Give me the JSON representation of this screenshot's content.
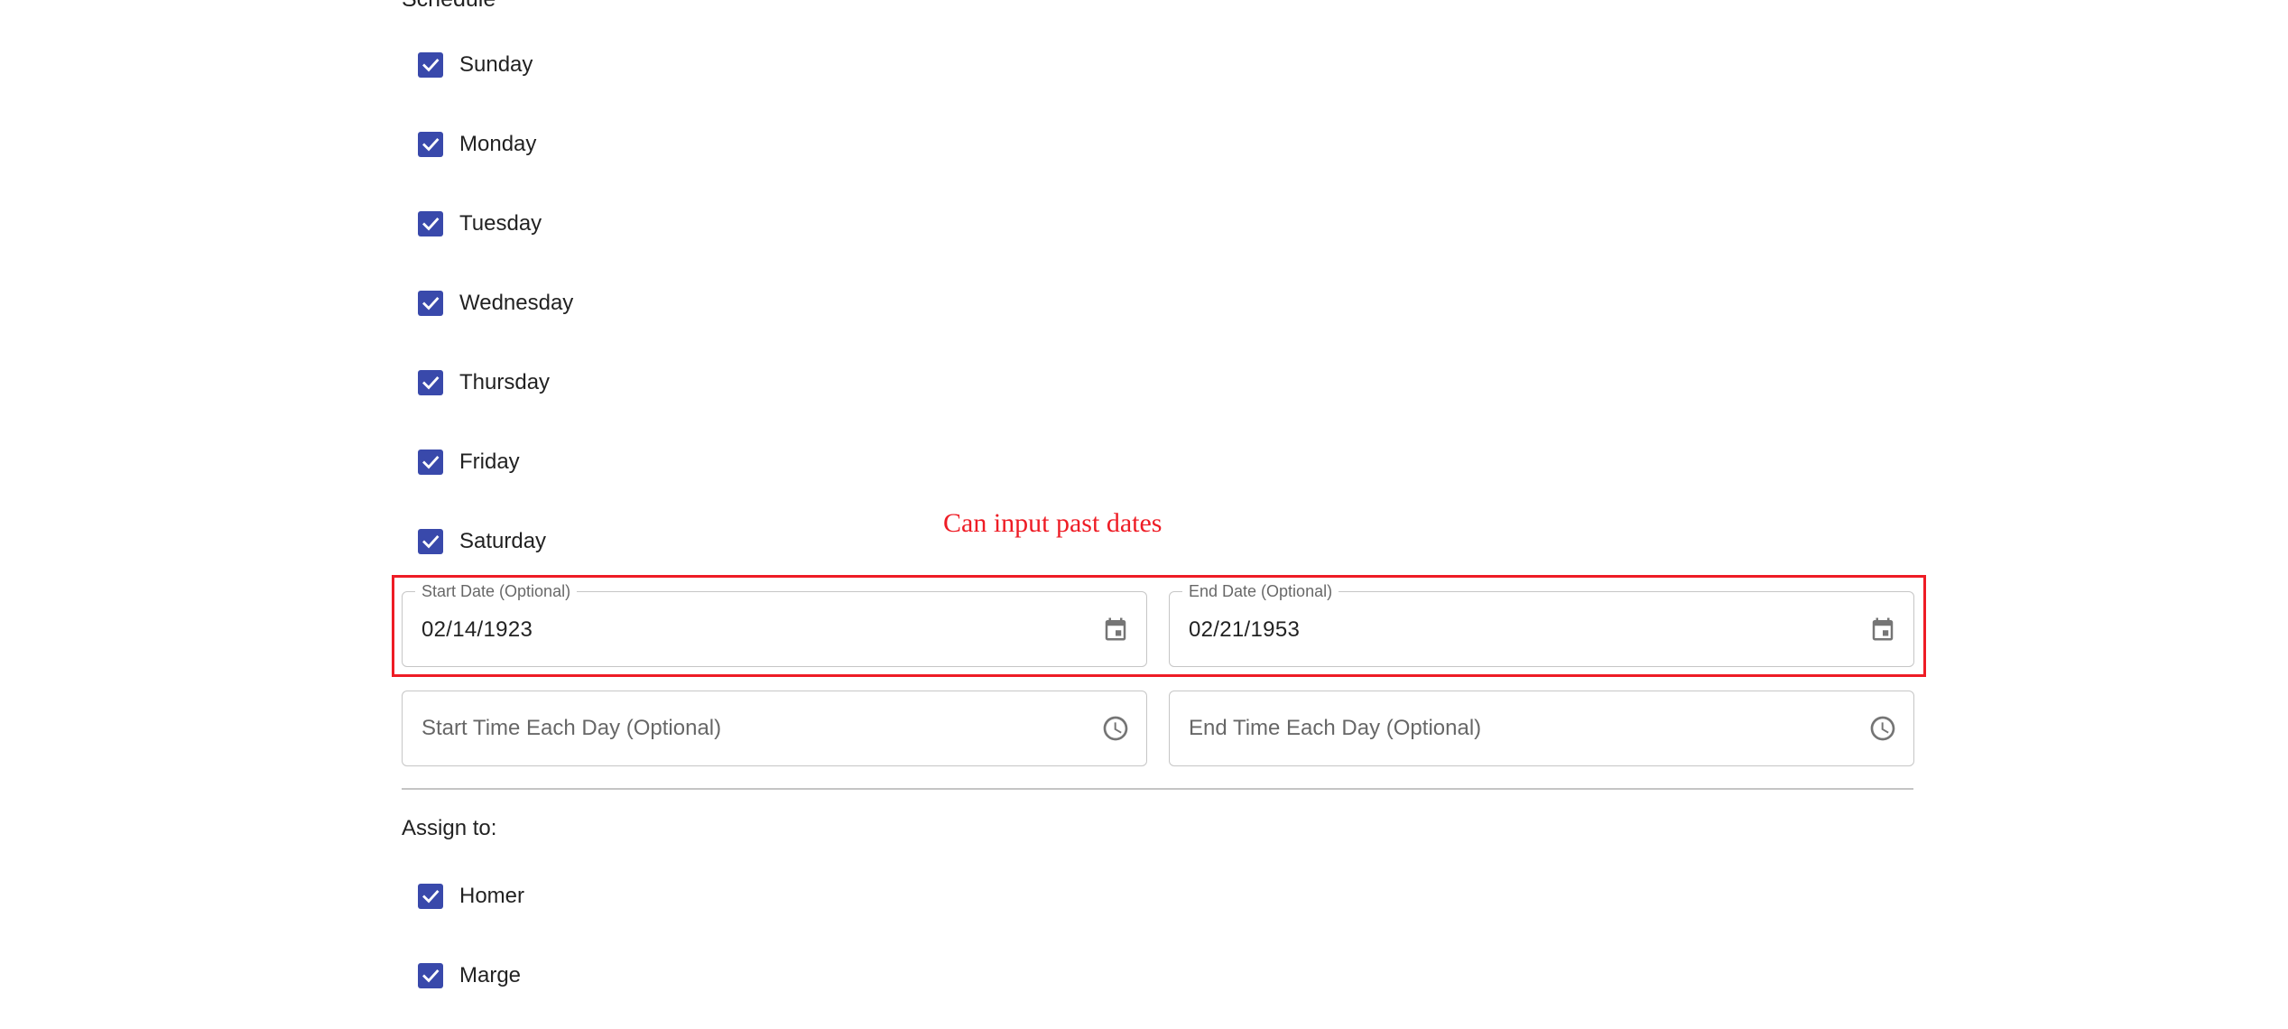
{
  "schedule": {
    "title": "Schedule",
    "days": [
      {
        "label": "Sunday",
        "checked": true
      },
      {
        "label": "Monday",
        "checked": true
      },
      {
        "label": "Tuesday",
        "checked": true
      },
      {
        "label": "Wednesday",
        "checked": true
      },
      {
        "label": "Thursday",
        "checked": true
      },
      {
        "label": "Friday",
        "checked": true
      },
      {
        "label": "Saturday",
        "checked": true
      }
    ]
  },
  "dates": {
    "start": {
      "label": "Start Date (Optional)",
      "value": "02/14/1923",
      "icon": "calendar-icon"
    },
    "end": {
      "label": "End Date (Optional)",
      "value": "02/21/1953",
      "icon": "calendar-icon"
    }
  },
  "times": {
    "start": {
      "placeholder": "Start Time Each Day (Optional)",
      "icon": "clock-icon"
    },
    "end": {
      "placeholder": "End Time Each Day (Optional)",
      "icon": "clock-icon"
    }
  },
  "assign": {
    "title": "Assign to:",
    "people": [
      {
        "label": "Homer",
        "checked": true
      },
      {
        "label": "Marge",
        "checked": true
      }
    ]
  },
  "annotation": {
    "text": "Can input past dates",
    "color": "#ee1c25"
  },
  "colors": {
    "checkbox": "#3949ab",
    "annotation": "#ee1c25"
  }
}
